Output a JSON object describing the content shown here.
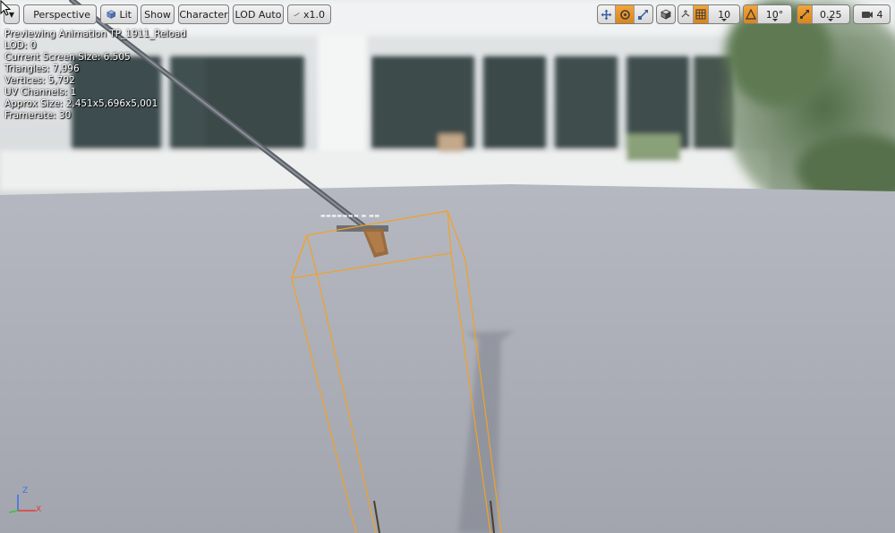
{
  "toolbar": {
    "dropdown_arrow": "▼",
    "perspective_label": "Perspective",
    "lit_label": "Lit",
    "show_label": "Show",
    "character_label": "Character",
    "lod_label": "LOD Auto",
    "speed_label": "x1.0",
    "grid_snap_value": "10",
    "rotation_snap_value": "10°",
    "scale_snap_value": "0.25",
    "camera_speed_value": "4",
    "icons": [
      "translate-icon",
      "rotate-icon",
      "scale-icon",
      "world-local-icon",
      "surface-snap-icon",
      "grid-snap-icon",
      "rotation-snap-icon",
      "scale-snap-icon",
      "camera-speed-icon"
    ],
    "accent_color": "#e8962b"
  },
  "stats": {
    "preview": "Previewing Animation TP_1911_Reload",
    "lod": "LOD: 0",
    "screen_size": "Current Screen Size: 6.505",
    "triangles": "Triangles: 7,996",
    "vertices": "Vertices: 5,792",
    "uv_channels": "UV Channels: 1",
    "approx_size": "Approx Size: 2,451x5,696x5,001",
    "framerate": "Framerate: 30"
  },
  "axis": {
    "z": "Z",
    "x": "X"
  },
  "colors": {
    "bounds": "#f2a127",
    "floor": "#a9abb4",
    "sky": "#e8ecef"
  }
}
